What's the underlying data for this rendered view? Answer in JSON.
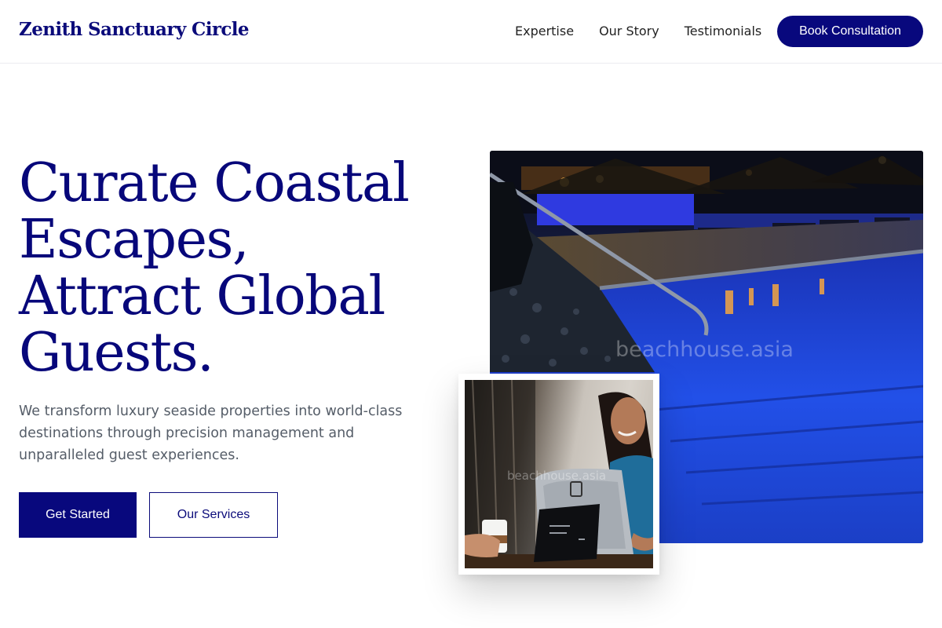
{
  "header": {
    "brand": "Zenith Sanctuary Circle",
    "nav": [
      "Expertise",
      "Our Story",
      "Testimonials"
    ],
    "cta_label": "Book Consultation"
  },
  "hero": {
    "title_lines": [
      "Curate Coastal",
      "Escapes,",
      "Attract Global",
      "Guests."
    ],
    "subtitle": "We transform luxury seaside properties into world-class destinations through precision management and unparalleled guest experiences.",
    "primary_button": "Get Started",
    "secondary_button": "Our Services"
  },
  "images": {
    "pool_alt": "Luxury resort pool at night with loungers and lit palapa umbrellas",
    "card_alt": "Smiling woman using a point-of-sale tablet at a counter",
    "watermark": "beachhouse.asia"
  },
  "colors": {
    "brand_navy": "#08087d",
    "body_text": "#555d68",
    "pool_blue": "#1f3fd0"
  }
}
